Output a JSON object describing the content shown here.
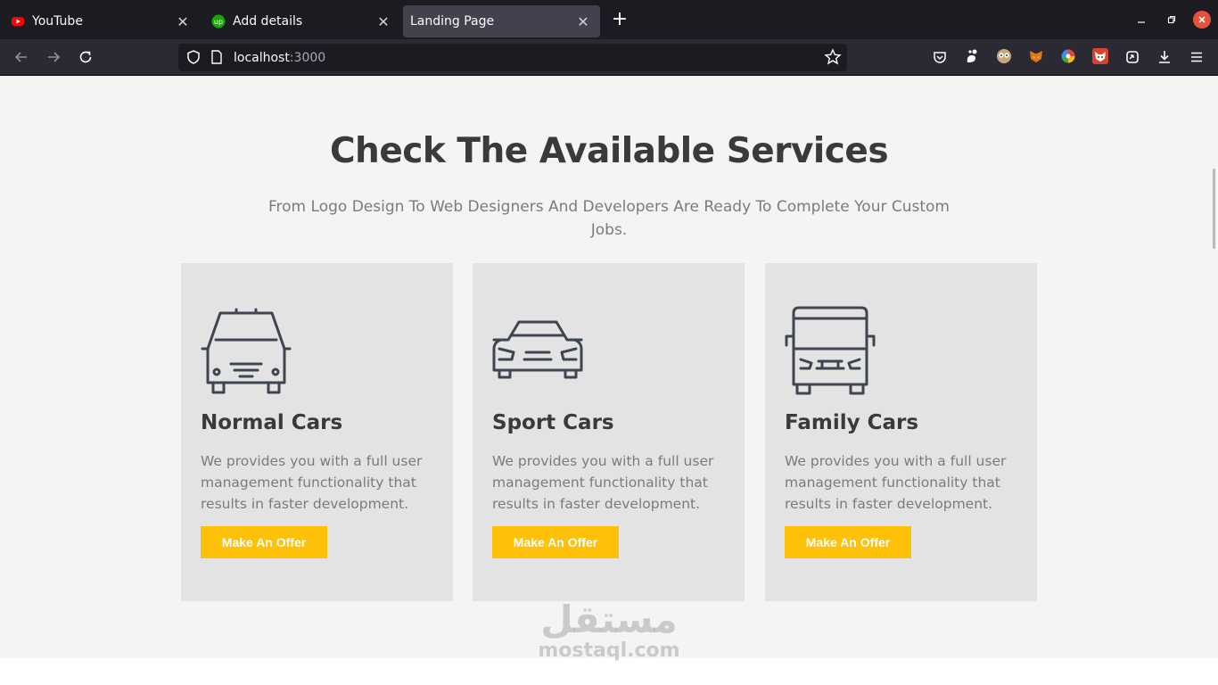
{
  "browser": {
    "tabs": [
      {
        "title": "YouTube",
        "icon": "youtube-icon"
      },
      {
        "title": "Add details",
        "icon": "upwork-icon"
      },
      {
        "title": "Landing Page",
        "icon": "none",
        "active": true
      }
    ],
    "url": {
      "host": "localhost",
      "port": ":3000"
    }
  },
  "services": {
    "heading": "Check The Available Services",
    "subheading": "From Logo Design To Web Designers And Developers Are Ready To Complete Your Custom Jobs.",
    "cards": [
      {
        "icon": "sedan-car-icon",
        "title": "Normal Cars",
        "description": "We provides you with a full user management functionality that results in faster development.",
        "button": "Make An Offer"
      },
      {
        "icon": "sport-car-icon",
        "title": "Sport Cars",
        "description": "We provides you with a full user management functionality that results in faster development.",
        "button": "Make An Offer"
      },
      {
        "icon": "van-icon",
        "title": "Family Cars",
        "description": "We provides you with a full user management functionality that results in faster development.",
        "button": "Make An Offer"
      }
    ]
  },
  "watermark": {
    "arabic": "مستقل",
    "latin": "mostaql.com"
  },
  "colors": {
    "accent": "#ffc107",
    "card_bg": "#e3e3e3",
    "section_bg": "#f4f4f4",
    "heading": "#3a3a3a",
    "text": "#7b7b7b"
  }
}
